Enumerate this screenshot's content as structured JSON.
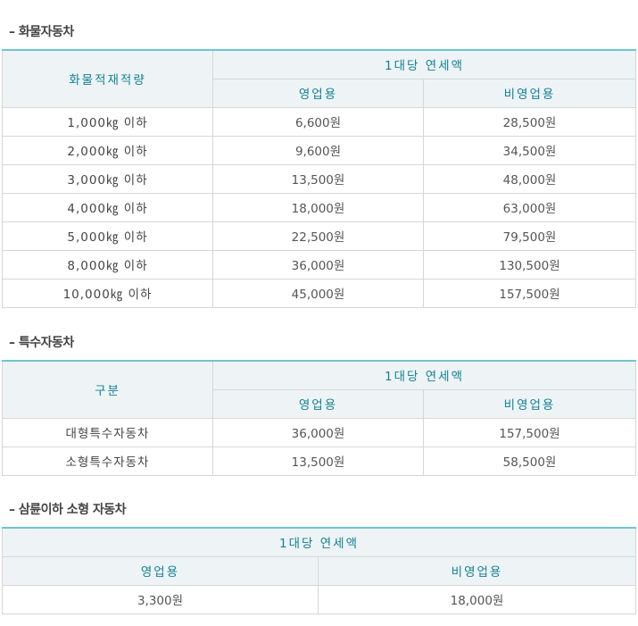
{
  "sections": [
    {
      "title": "– 화물자동차",
      "col1_header": "화물적재적량",
      "group_header": "1대당 연세액",
      "sub_headers": [
        "영업용",
        "비영업용"
      ],
      "rows": [
        {
          "label": "1,000㎏ 이하",
          "commercial": "6,600원",
          "noncommercial": "28,500원"
        },
        {
          "label": "2,000㎏ 이하",
          "commercial": "9,600원",
          "noncommercial": "34,500원"
        },
        {
          "label": "3,000㎏ 이하",
          "commercial": "13,500원",
          "noncommercial": "48,000원"
        },
        {
          "label": "4,000㎏ 이하",
          "commercial": "18,000원",
          "noncommercial": "63,000원"
        },
        {
          "label": "5,000㎏ 이하",
          "commercial": "22,500원",
          "noncommercial": "79,500원"
        },
        {
          "label": "8,000㎏ 이하",
          "commercial": "36,000원",
          "noncommercial": "130,500원"
        },
        {
          "label": "10,000㎏ 이하",
          "commercial": "45,000원",
          "noncommercial": "157,500원"
        }
      ]
    },
    {
      "title": "– 특수자동차",
      "col1_header": "구분",
      "group_header": "1대당 연세액",
      "sub_headers": [
        "영업용",
        "비영업용"
      ],
      "rows": [
        {
          "label": "대형특수자동차",
          "commercial": "36,000원",
          "noncommercial": "157,500원"
        },
        {
          "label": "소형특수자동차",
          "commercial": "13,500원",
          "noncommercial": "58,500원"
        }
      ]
    },
    {
      "title": "– 삼륜이하 소형 자동차",
      "group_header": "1대당 연세액",
      "sub_headers": [
        "영업용",
        "비영업용"
      ],
      "row": {
        "commercial": "3,300원",
        "noncommercial": "18,000원"
      }
    }
  ]
}
